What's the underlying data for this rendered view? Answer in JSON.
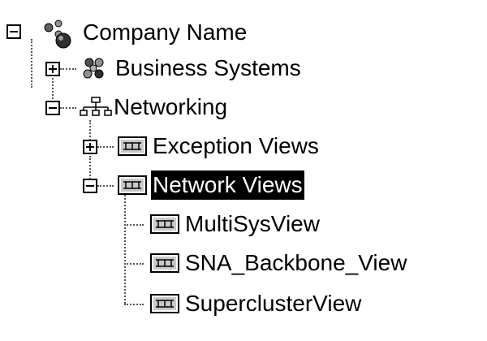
{
  "tree": {
    "selection_colors": {
      "background": "#000000",
      "text": "#ffffff"
    },
    "nodes": [
      {
        "label": "Company Name",
        "icon": "company-icon",
        "state": "expanded",
        "selected": false
      },
      {
        "label": "Business Systems",
        "icon": "business-systems-icon",
        "state": "collapsed",
        "selected": false
      },
      {
        "label": "Networking",
        "icon": "network-topology-icon",
        "state": "expanded",
        "selected": false
      },
      {
        "label": "Exception Views",
        "icon": "view-icon",
        "state": "collapsed",
        "selected": false
      },
      {
        "label": "Network Views",
        "icon": "view-icon",
        "state": "expanded",
        "selected": true
      },
      {
        "label": "MultiSysView",
        "icon": "view-icon",
        "state": "leaf",
        "selected": false
      },
      {
        "label": "SNA_Backbone_View",
        "icon": "view-icon",
        "state": "leaf",
        "selected": false
      },
      {
        "label": "SuperclusterView",
        "icon": "view-icon",
        "state": "leaf",
        "selected": false
      }
    ]
  }
}
